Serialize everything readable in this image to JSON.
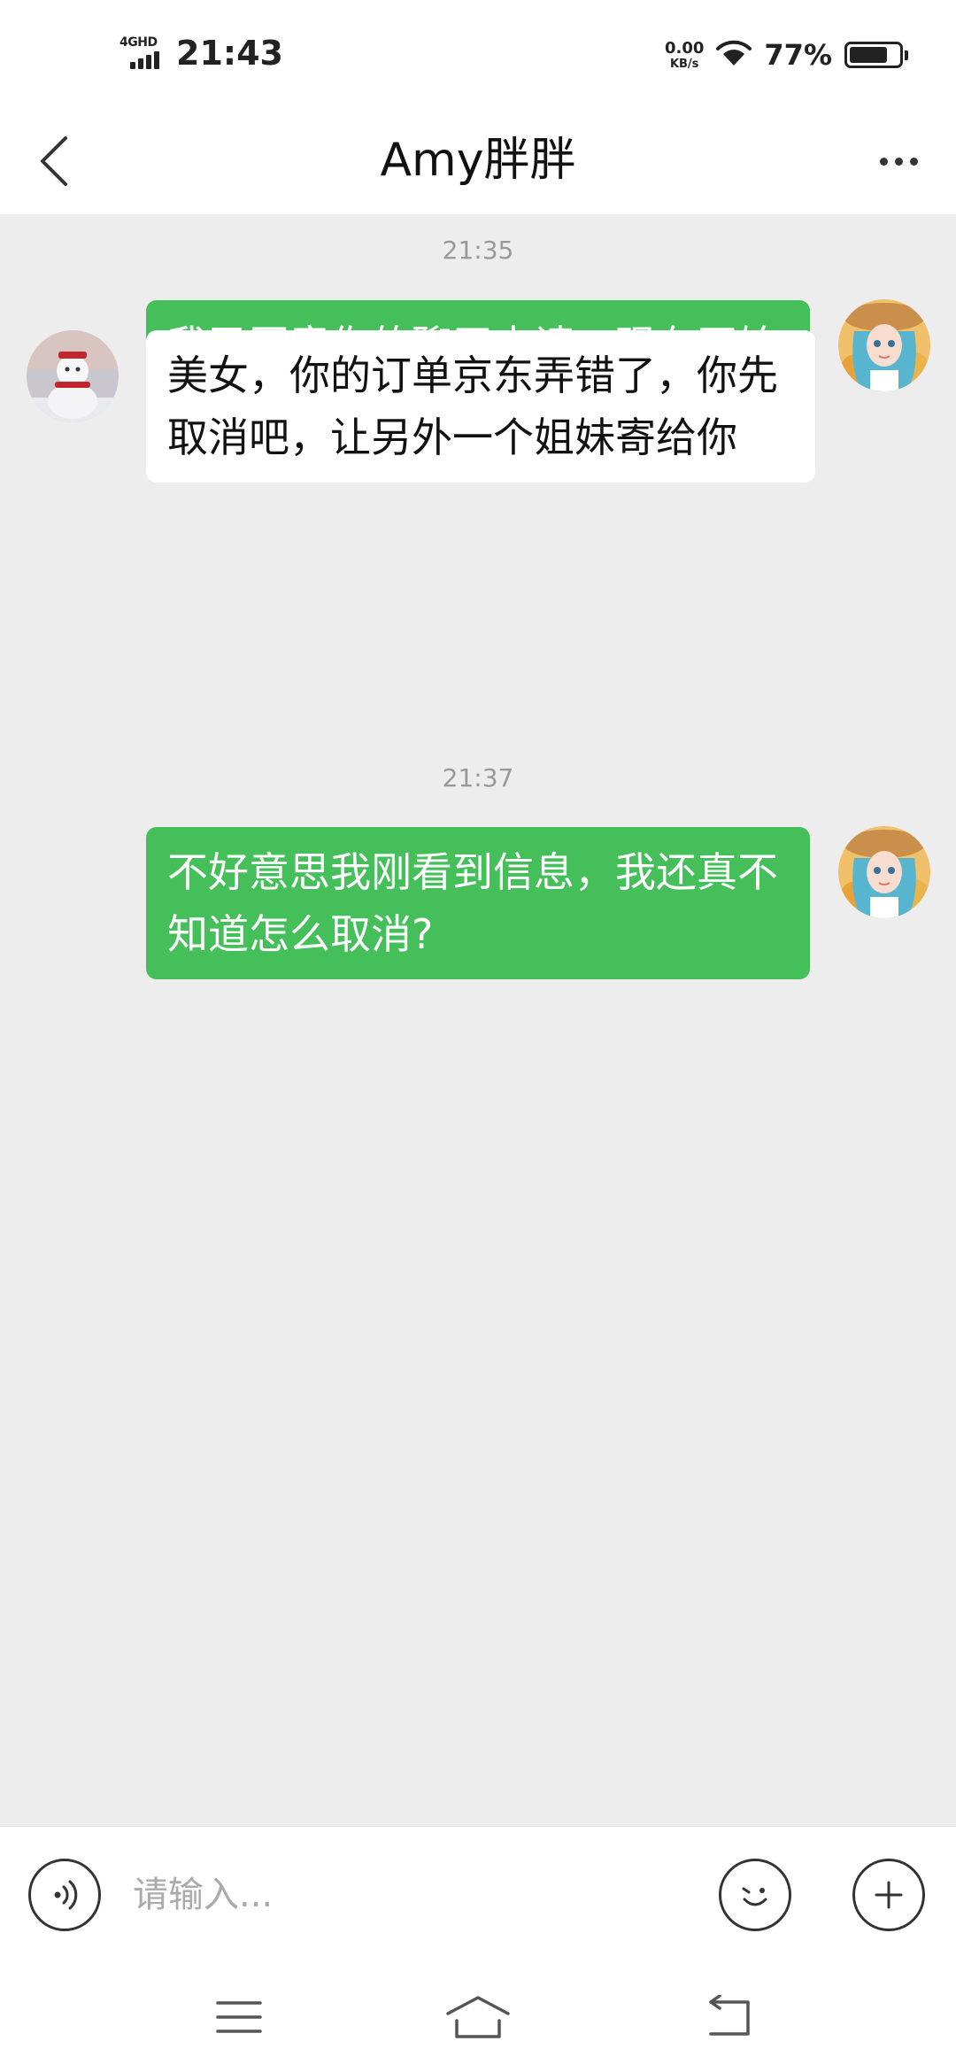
{
  "status_bar": {
    "network": "4GHD",
    "time": "21:43",
    "speed_value": "0.00",
    "speed_unit": "KB/s",
    "battery_percent": "77%",
    "battery_level": 0.77
  },
  "header": {
    "title": "Amy胖胖"
  },
  "messages": [
    {
      "type": "timestamp",
      "text": "21:35"
    },
    {
      "type": "outgoing",
      "text": "我已同意你的聊天申请，现在开始聊天吧!"
    },
    {
      "type": "incoming",
      "text": "美女，你的订单京东弄错了，你先取消吧，让另外一个姐妹寄给你"
    },
    {
      "type": "timestamp",
      "text": "21:37"
    },
    {
      "type": "outgoing",
      "text": "不好意思我刚看到信息，我还真不知道怎么取消?"
    }
  ],
  "input": {
    "placeholder": "请输入..."
  },
  "colors": {
    "outgoing_bubble": "#44bf5a",
    "incoming_bubble": "#ffffff",
    "chat_background": "#ededed"
  },
  "icons": {
    "back": "chevron-left-icon",
    "more": "more-dots-icon",
    "voice": "voice-icon",
    "emoji": "emoji-icon",
    "add": "plus-icon",
    "menu": "menu-icon",
    "home": "home-icon",
    "return": "back-arrow-icon"
  }
}
